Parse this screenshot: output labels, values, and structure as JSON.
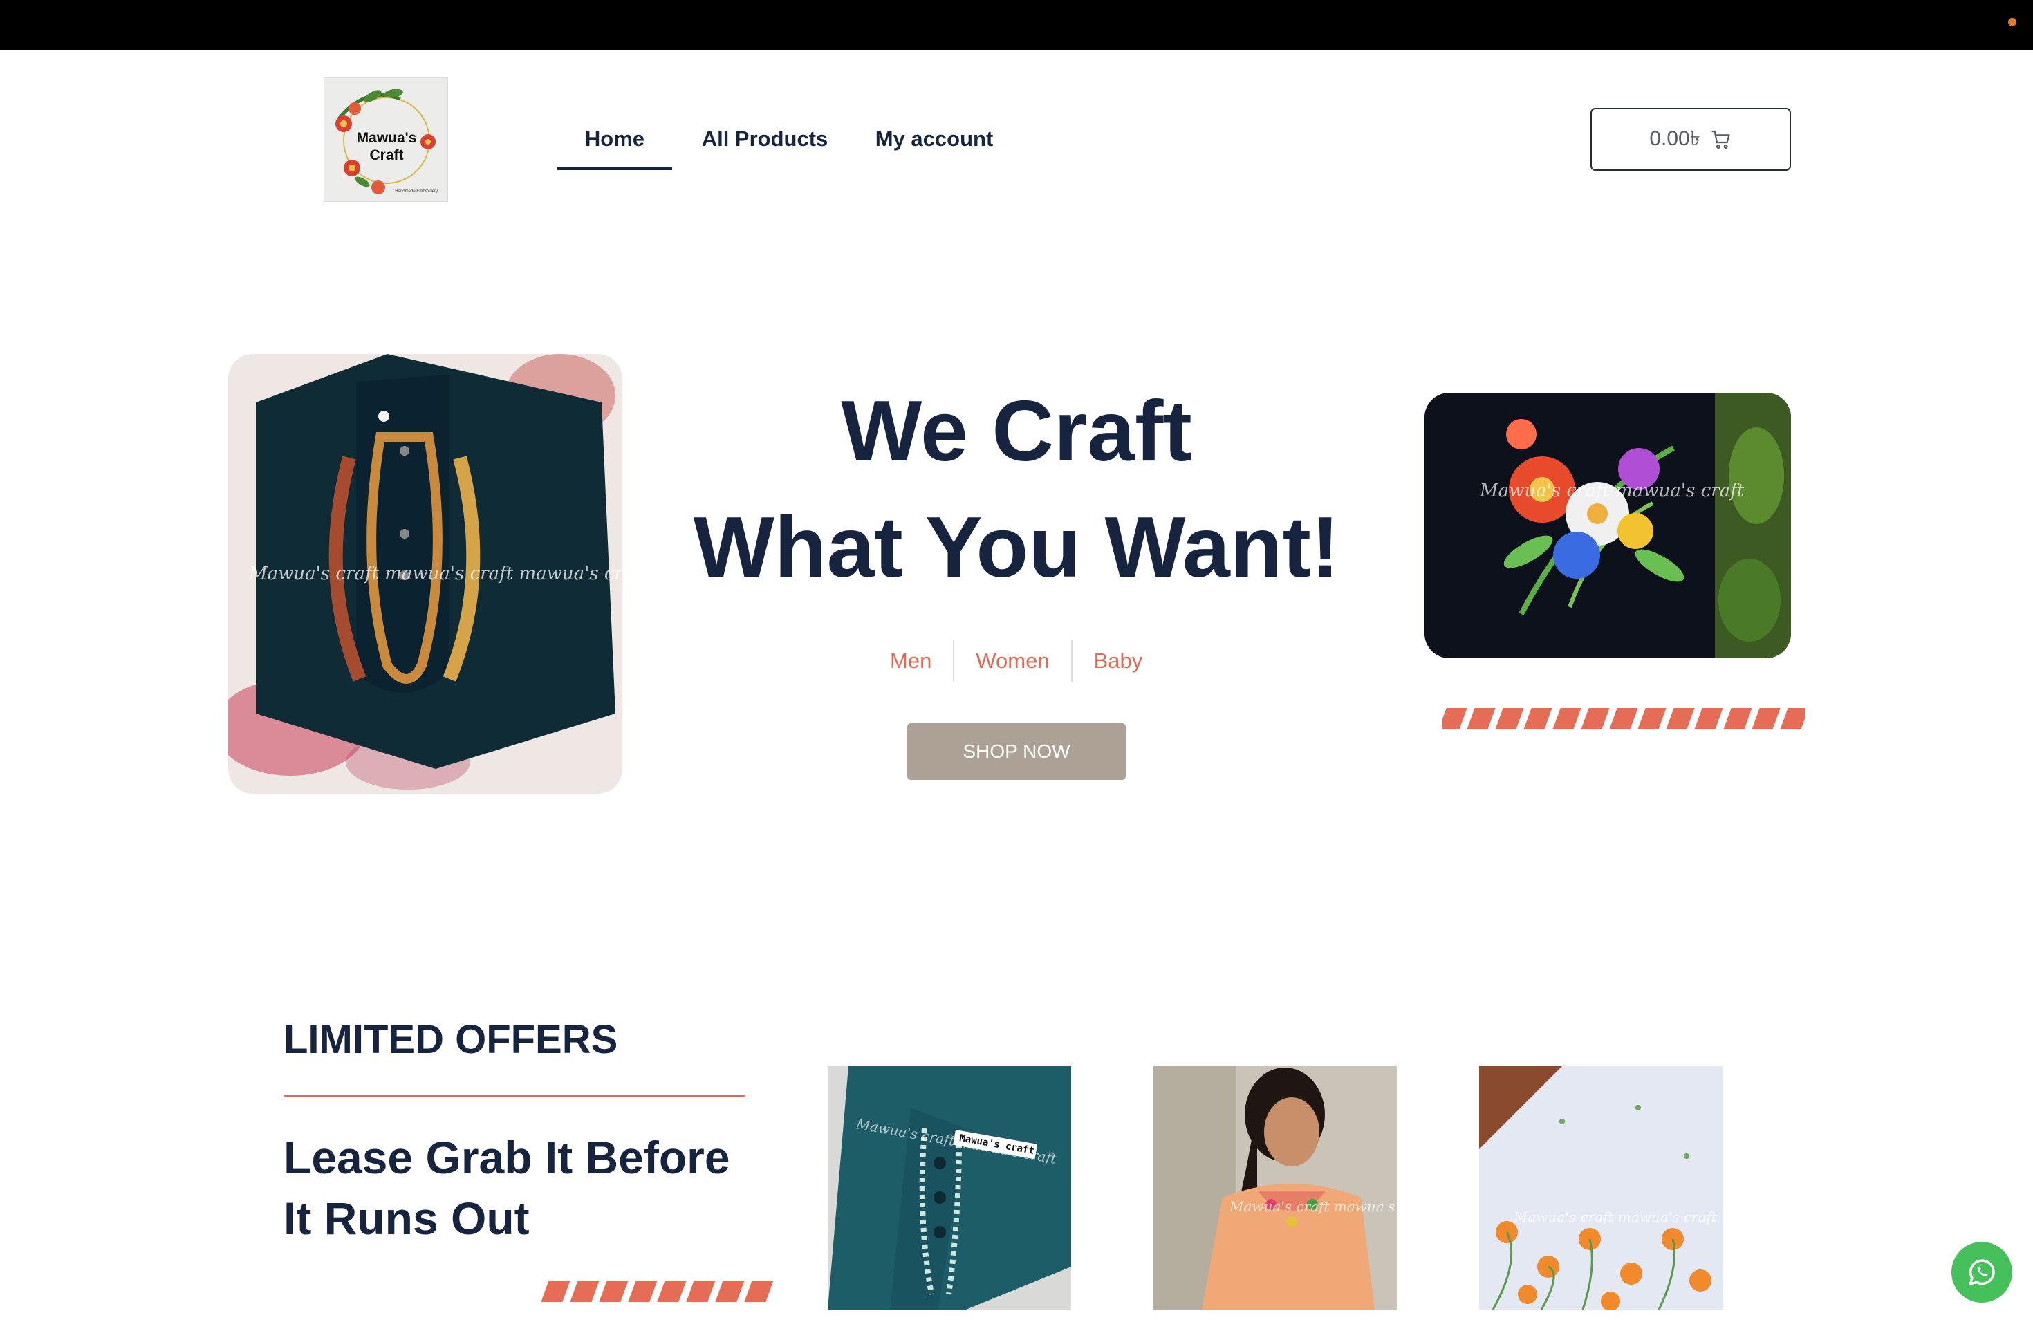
{
  "colors": {
    "topbar": "#000000",
    "topbar_dot": "#e07b2e",
    "navy": "#16243f",
    "accent": "#e06a53",
    "button": "#ada195",
    "whatsapp": "#45c05b"
  },
  "logo": {
    "line1": "Mawua's",
    "line2": "Craft",
    "sub": "Handmade Embroidery"
  },
  "nav": {
    "items": [
      {
        "label": "Home",
        "active": true
      },
      {
        "label": "All Products",
        "active": false
      },
      {
        "label": "My account",
        "active": false
      }
    ]
  },
  "cart": {
    "amount": "0.00৳",
    "icon": "shopping-cart-icon"
  },
  "hero": {
    "headline_line1": "We Craft",
    "headline_line2": "What You Want!",
    "categories": [
      "Men",
      "Women",
      "Baby"
    ],
    "cta": "SHOP NOW",
    "left_watermark": "Mawua's craft mawua's craft mawua's craft",
    "right_watermark": "Mawua's craft mawua's craft"
  },
  "offers": {
    "title": "LIMITED OFFERS",
    "subtitle": "Lease Grab It Before It Runs Out",
    "products": [
      {
        "watermark": "Mawua's craft mawua's craft",
        "tag": "Mawua's craft"
      },
      {
        "watermark": "Mawua's craft mawua's craft"
      },
      {
        "watermark": "Mawua's craft mawua's craft"
      }
    ]
  },
  "floating": {
    "whatsapp_icon": "whatsapp-icon"
  }
}
